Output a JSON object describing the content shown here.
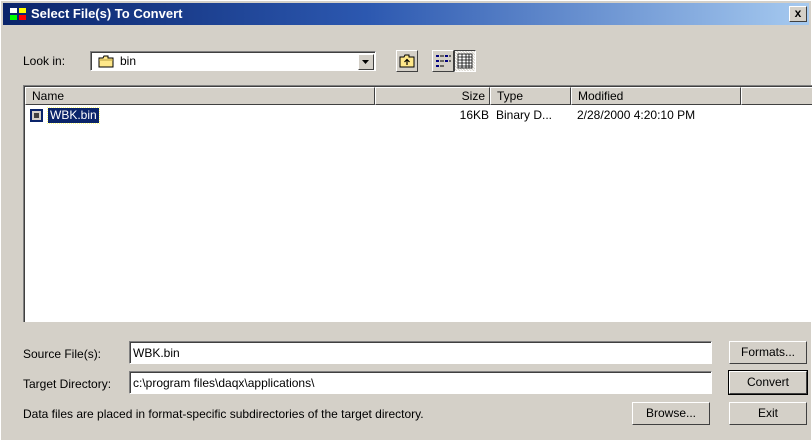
{
  "window": {
    "title": "Select File(s) To Convert",
    "close_label": "x"
  },
  "lookin": {
    "label": "Look in:",
    "value": "bin"
  },
  "columns": [
    "Name",
    "Size",
    "Type",
    "Modified"
  ],
  "files": [
    {
      "name": "WBK.bin",
      "size": "16KB",
      "type": "Binary D...",
      "modified": "2/28/2000 4:20:10 PM"
    }
  ],
  "source": {
    "label": "Source File(s):",
    "value": "WBK.bin"
  },
  "target": {
    "label": "Target Directory:",
    "value": "c:\\program files\\daqx\\applications\\"
  },
  "note": "Data files are placed in format-specific subdirectories of the target directory.",
  "buttons": {
    "formats": "Formats...",
    "convert": "Convert",
    "browse": "Browse...",
    "exit": "Exit"
  },
  "colors": {
    "titlebar_start": "#0a246a",
    "titlebar_end": "#a6caf0",
    "dialog_bg": "#d4d0c8",
    "selection": "#0a246a"
  }
}
